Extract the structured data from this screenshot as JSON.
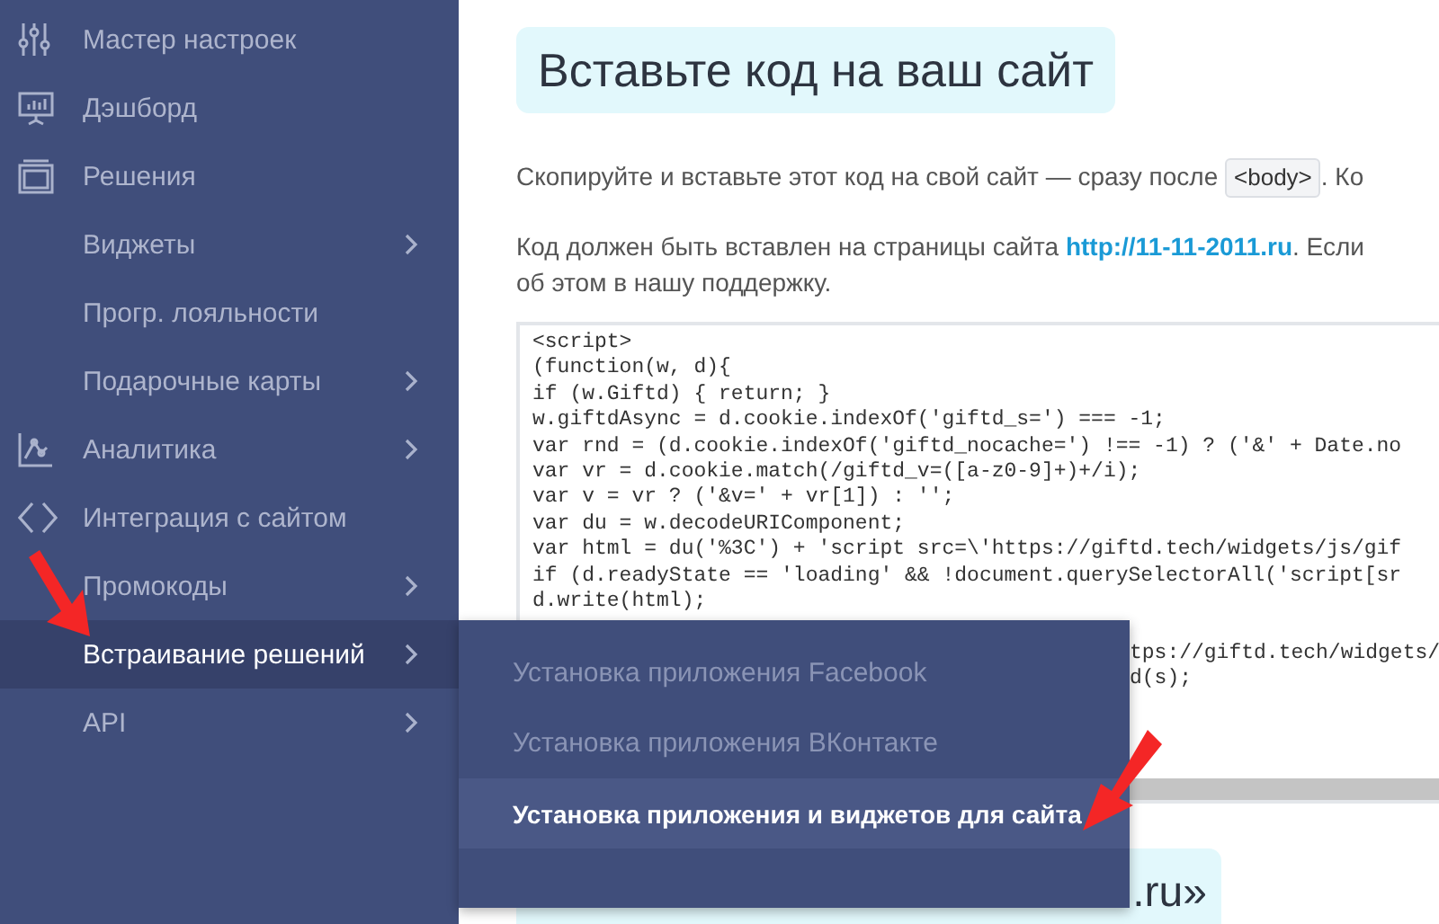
{
  "sidebar": {
    "items": [
      {
        "label": "Мастер настроек",
        "chevron": false,
        "selected": false
      },
      {
        "label": "Дэшборд",
        "chevron": false,
        "selected": false
      },
      {
        "label": "Решения",
        "chevron": false,
        "selected": false
      },
      {
        "label": "Виджеты",
        "chevron": true,
        "selected": false
      },
      {
        "label": "Прогр. лояльности",
        "chevron": false,
        "selected": false
      },
      {
        "label": "Подарочные карты",
        "chevron": true,
        "selected": false
      },
      {
        "label": "Аналитика",
        "chevron": true,
        "selected": false
      },
      {
        "label": "Интеграция с сайтом",
        "chevron": false,
        "selected": false
      },
      {
        "label": "Промокоды",
        "chevron": true,
        "selected": false
      },
      {
        "label": "Встраивание решений",
        "chevron": true,
        "selected": true
      },
      {
        "label": "API",
        "chevron": true,
        "selected": false
      }
    ]
  },
  "submenu": {
    "items": [
      {
        "label": "Установка приложения Facebook",
        "selected": false
      },
      {
        "label": "Установка приложения ВКонтакте",
        "selected": false
      },
      {
        "label": "Установка приложения и виджетов для сайта",
        "selected": true
      }
    ]
  },
  "content": {
    "title": "Вставьте код на ваш сайт",
    "intro": {
      "before": "Скопируйте и вставьте этот код на свой сайт — сразу после",
      "tag": "<body>",
      "after": ". Ко"
    },
    "note": {
      "before": "Код должен быть вставлен на страницы сайта",
      "link": "http://11-11-2011.ru",
      "after": ". Если",
      "second_line": "об этом в нашу поддержку."
    },
    "code_lines": [
      {
        "text": "<script>",
        "kind": "full"
      },
      {
        "text": "(function(w, d){",
        "kind": "full"
      },
      {
        "text": "if (w.Giftd) { return; }",
        "kind": "full"
      },
      {
        "text": "w.giftdAsync = d.cookie.indexOf('giftd_s=') === -1;",
        "kind": "full"
      },
      {
        "text": "var rnd = (d.cookie.indexOf('giftd_nocache=') !== -1) ? ('&' + Date.no",
        "kind": "full"
      },
      {
        "text": "var vr = d.cookie.match(/giftd_v=([a-z0-9]+)+/i);",
        "kind": "full"
      },
      {
        "text": "var v = vr ? ('&v=' + vr[1]) : '';",
        "kind": "full"
      },
      {
        "text": "var du = w.decodeURIComponent;",
        "kind": "full"
      },
      {
        "text": "var html = du('%3C') + 'script src=\\'https://giftd.tech/widgets/js/gif",
        "kind": "full"
      },
      {
        "text": "if (d.readyState == 'loading' && !document.querySelectorAll('script[sr",
        "kind": "full"
      },
      {
        "text": "d.write(html);",
        "kind": "full"
      },
      {
        "kind": "blank"
      },
      {
        "text": "tps://giftd.tech/widgets/",
        "kind": "covered"
      },
      {
        "text": "d(s);",
        "kind": "covered"
      }
    ],
    "second_heading": ".ru»"
  }
}
